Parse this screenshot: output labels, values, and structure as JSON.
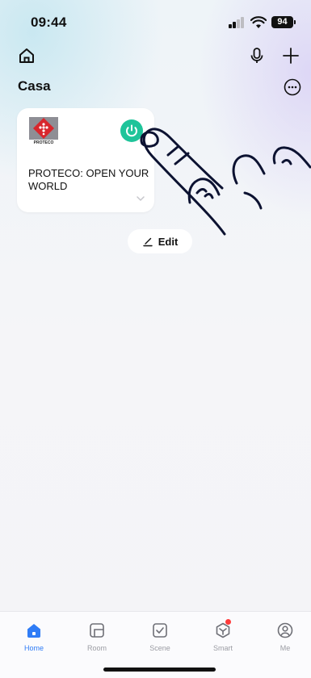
{
  "status_bar": {
    "time": "09:44",
    "battery": "94"
  },
  "header": {
    "title": "Casa"
  },
  "device_card": {
    "name": "PROTECO: OPEN YOUR WORLD",
    "logo_text": "PROTECO",
    "power_color": "#1fc49a"
  },
  "edit": {
    "label": "Edit"
  },
  "tabs": [
    {
      "label": "Home",
      "icon": "home-icon",
      "active": true
    },
    {
      "label": "Room",
      "icon": "room-icon",
      "active": false
    },
    {
      "label": "Scene",
      "icon": "scene-icon",
      "active": false
    },
    {
      "label": "Smart",
      "icon": "smart-icon",
      "active": false
    },
    {
      "label": "Me",
      "icon": "profile-icon",
      "active": false
    }
  ],
  "colors": {
    "accent": "#2f7cf6",
    "badge": "#ff3b3b"
  }
}
